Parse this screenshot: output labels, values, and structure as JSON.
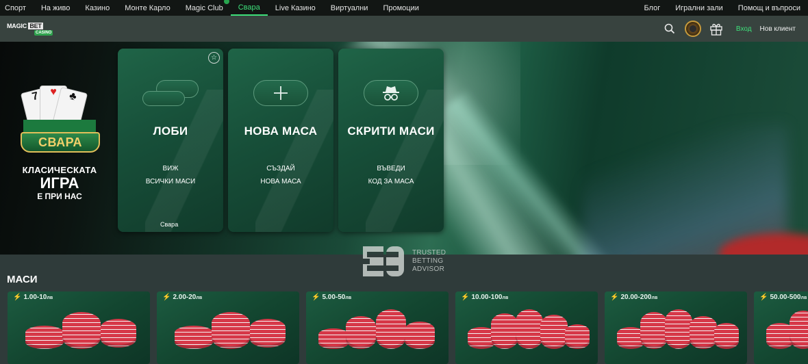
{
  "topnav": {
    "left": [
      "Спорт",
      "На живо",
      "Казино",
      "Монте Карло",
      "Magic Club",
      "Свара",
      "Live Казино",
      "Виртуални",
      "Промоции"
    ],
    "active": "Свара",
    "right": [
      "Блог",
      "Игрални зали",
      "Помощ и въпроси"
    ]
  },
  "header": {
    "logo_top": "MAGIC",
    "logo_bet": "BET",
    "logo_sub": "CASINO",
    "login": "Вход",
    "register": "Нов клиент"
  },
  "promo": {
    "badge": "СВАРА",
    "line1": "КЛАСИЧЕСКАТА",
    "line2": "ИГРА",
    "line3": "Е ПРИ НАС"
  },
  "tiles": [
    {
      "title": "ЛОБИ",
      "sub1": "ВИЖ",
      "sub2": "ВСИЧКИ МАСИ",
      "foot": "Свара"
    },
    {
      "title": "НОВА МАСА",
      "sub1": "СЪЗДАЙ",
      "sub2": "НОВА МАСА"
    },
    {
      "title": "СКРИТИ МАСИ",
      "sub1": "ВЪВЕДИ",
      "sub2": "КОД ЗА МАСА"
    }
  ],
  "watermark": {
    "l1": "TRUSTED",
    "l2": "BETTING",
    "l3": "ADVISOR"
  },
  "section": {
    "title": "МАСИ"
  },
  "tables": [
    {
      "stake": "1.00-10",
      "cur": "лв"
    },
    {
      "stake": "2.00-20",
      "cur": "лв"
    },
    {
      "stake": "5.00-50",
      "cur": "лв"
    },
    {
      "stake": "10.00-100",
      "cur": "лв"
    },
    {
      "stake": "20.00-200",
      "cur": "лв"
    },
    {
      "stake": "50.00-500",
      "cur": "лв"
    }
  ],
  "colors": {
    "accent": "#3ee07a",
    "tile": "#1a5a40",
    "chip": "#d63848"
  }
}
